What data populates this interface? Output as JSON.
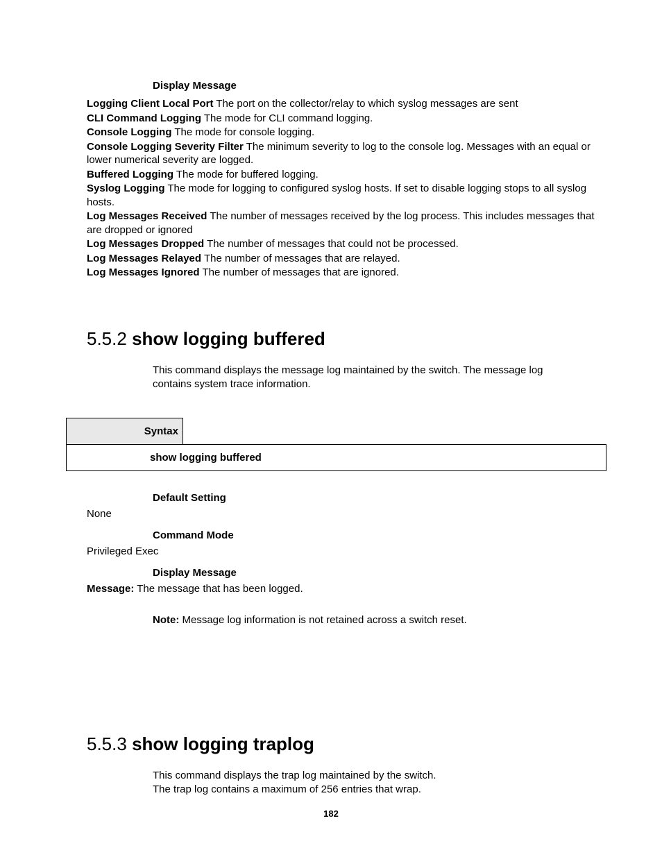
{
  "sec1": {
    "display_header": "Display Message",
    "defs": [
      {
        "term": "Logging Client Local Port",
        "desc": " The port on the collector/relay to which syslog messages are sent"
      },
      {
        "term": "CLI Command Logging",
        "desc": " The mode for CLI command logging."
      },
      {
        "term": "Console Logging",
        "desc": " The mode for console logging."
      },
      {
        "term": "Console Logging Severity Filter",
        "desc": " The minimum severity to log to the console log. Messages with an equal or lower numerical severity are logged."
      },
      {
        "term": "Buffered Logging",
        "desc": " The mode for buffered logging."
      },
      {
        "term": "Syslog Logging",
        "desc": " The mode for logging to configured syslog hosts. If set to disable logging stops to all syslog hosts."
      },
      {
        "term": "Log Messages Received",
        "desc": " The number of messages received by the log process. This includes messages that are dropped or ignored"
      },
      {
        "term": "Log Messages Dropped",
        "desc": " The number of messages that could not be processed."
      },
      {
        "term": "Log Messages Relayed",
        "desc": " The number of messages that are relayed."
      },
      {
        "term": "Log Messages Ignored",
        "desc": " The number of messages that are ignored."
      }
    ]
  },
  "sec2": {
    "num": "5.5.2 ",
    "title": "show logging buffered",
    "intro": "This command displays the message log maintained by the switch. The message log contains system trace information.",
    "syntax_label": "Syntax",
    "syntax_cmd": "show logging buffered",
    "default_label": "Default Setting",
    "default_value": "None",
    "mode_label": "Command Mode",
    "mode_value": "Privileged Exec",
    "display_label": "Display Message",
    "msg_term": "Message:",
    "msg_desc": " The message that has been logged.",
    "note_term": "Note:",
    "note_desc": " Message log information is not retained across a switch reset."
  },
  "sec3": {
    "num": "5.5.3 ",
    "title": "show logging traplog",
    "intro1": "This command displays the trap log maintained by the switch.",
    "intro2": "The trap log contains a maximum of 256 entries that wrap."
  },
  "page_number": "182"
}
